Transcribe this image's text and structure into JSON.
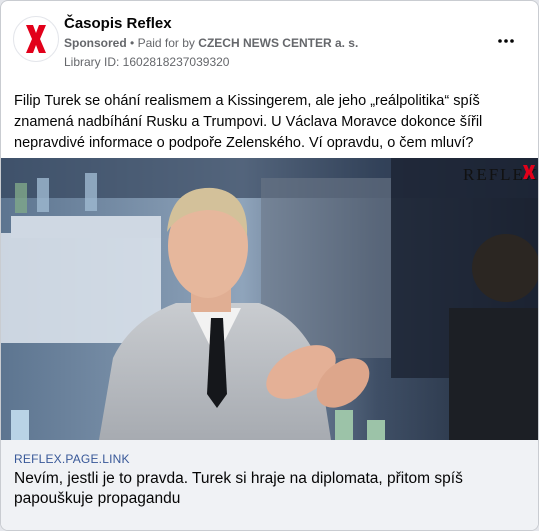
{
  "post": {
    "page_name": "Časopis Reflex",
    "sponsored_label": "Sponsored",
    "separator": "•",
    "paid_for_prefix": "Paid for by",
    "advertiser": "CZECH NEWS CENTER a. s.",
    "library_id": "Library ID: 1602818237039320",
    "more_icon": "more-horizontal-icon",
    "text": "Filip Turek se ohání realismem a Kissingerem, ale jeho „reálpolitika“ spíš znamená nadbíhání Rusku a Trumpovi. U Václava Moravce dokonce šířil nepravdivé informace o podpoře Zelenského. Ví opravdu, o čem mluví?"
  },
  "image": {
    "watermark": "REFLEX",
    "brand_color": "#e2001a"
  },
  "link": {
    "domain": "REFLEX.PAGE.LINK",
    "title": "Nevím, jestli je to pravda. Turek si hraje na diplomata, přitom spíš papouškuje propagandu"
  }
}
